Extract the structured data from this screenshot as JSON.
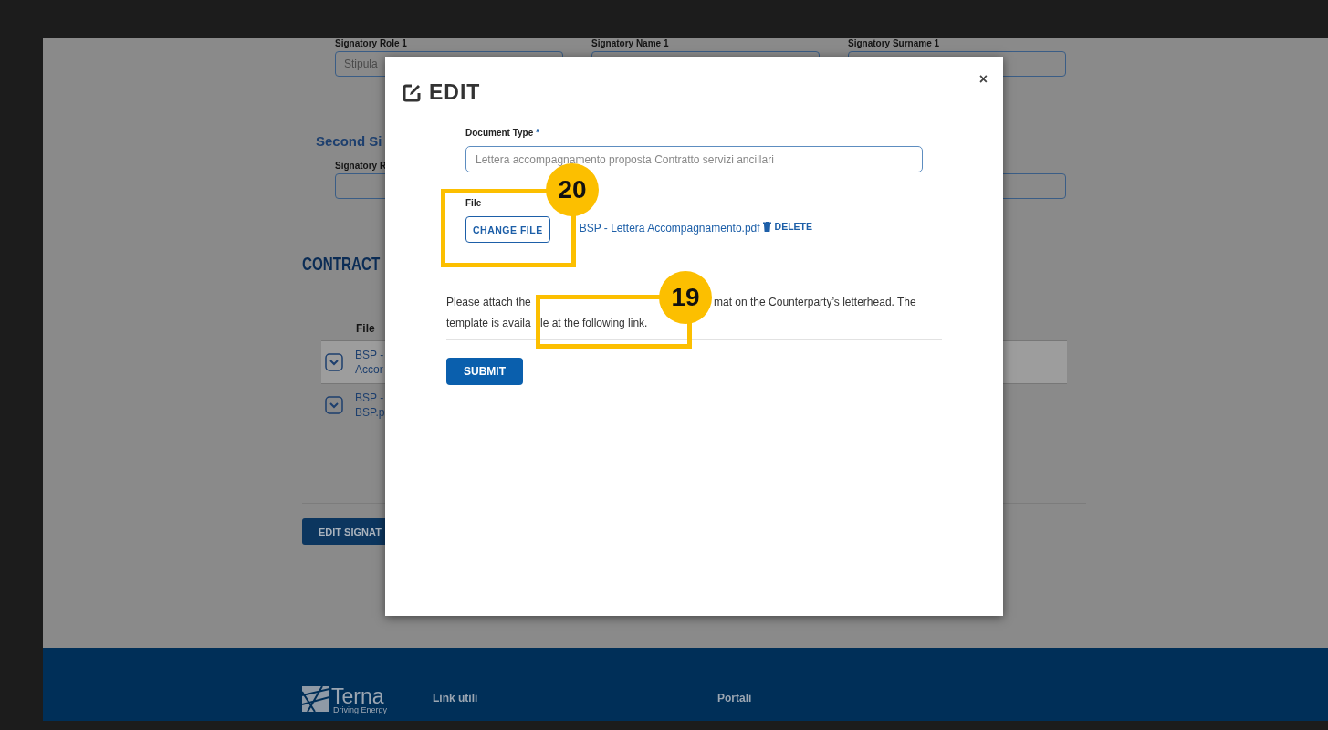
{
  "background_page": {
    "first_signatory": {
      "fields": [
        {
          "label": "Signatory Role 1",
          "placeholder": "Stipula"
        },
        {
          "label": "Signatory Name 1"
        },
        {
          "label": "Signatory Surname 1"
        }
      ]
    },
    "second_signatory": {
      "heading": "Second Si",
      "fields": [
        {
          "label": "Signatory R"
        }
      ]
    },
    "contract": {
      "heading": "CONTRACT",
      "table": {
        "columns": [
          "File"
        ],
        "rows": [
          {
            "file_lines": [
              "BSP -",
              "Accor"
            ],
            "shaded": true
          },
          {
            "file_lines": [
              "BSP -",
              "BSP.p"
            ],
            "shaded": false
          }
        ]
      }
    },
    "edit_button": "EDIT SIGNAT"
  },
  "modal": {
    "title": "EDIT",
    "close": "×",
    "document_type": {
      "label": "Document Type",
      "required_mark": "*",
      "placeholder": "Lettera accompagnamento proposta Contratto servizi ancillari"
    },
    "file": {
      "label": "File",
      "change_button": "CHANGE FILE",
      "file_name": "BSP - Lettera Accompagnamento.pdf",
      "delete": "DELETE"
    },
    "instructions": {
      "line_1": [
        "Please attach the",
        "mat on the Counterparty’s letterhead. The"
      ],
      "line_2": [
        "template is availa",
        "le at the"
      ],
      "link": "following link",
      "end": "."
    },
    "submit": "SUBMIT"
  },
  "annotations": [
    {
      "number": "20"
    },
    {
      "number": "19"
    }
  ],
  "footer": {
    "logo": {
      "name": "Terna",
      "tagline": "Driving Energy"
    },
    "columns": [
      "Link utili",
      "Portali"
    ]
  }
}
